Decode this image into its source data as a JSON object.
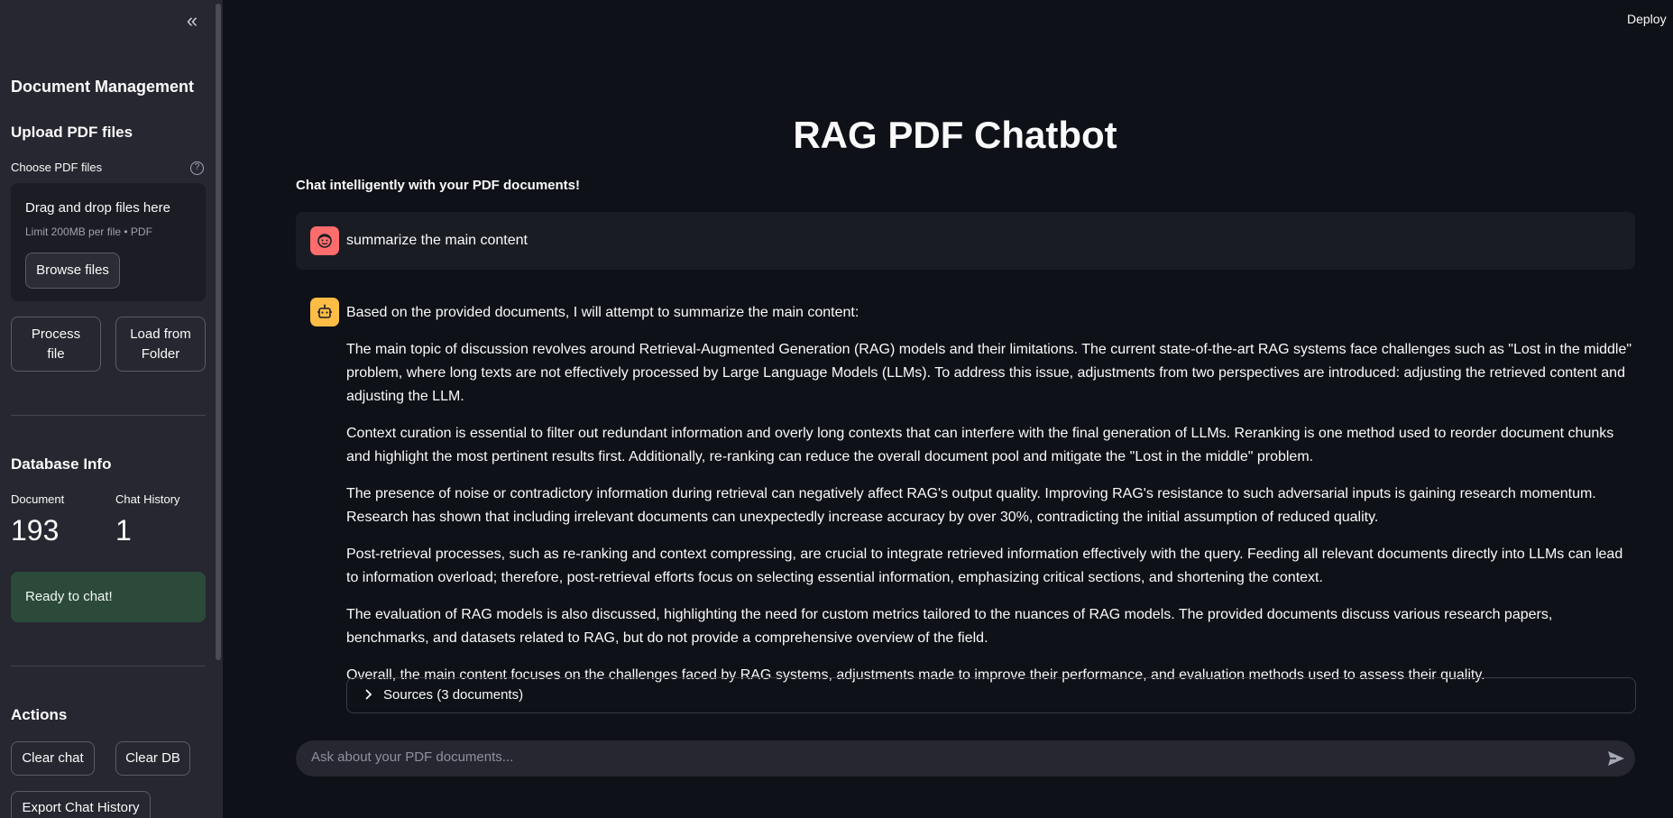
{
  "header": {
    "deploy_label": "Deploy"
  },
  "sidebar": {
    "collapse_icon": "double-chevron-left-icon",
    "section_title": "Document Management",
    "upload_title": "Upload PDF files",
    "file_uploader": {
      "label": "Choose PDF files",
      "drop_text": "Drag and drop files here",
      "limit_text": "Limit 200MB per file • PDF",
      "browse_label": "Browse files"
    },
    "process_button": "Process file",
    "load_button": "Load from Folder",
    "database_title": "Database Info",
    "metrics": [
      {
        "label": "Document",
        "value": "193"
      },
      {
        "label": "Chat History",
        "value": "1"
      }
    ],
    "status_message": "Ready to chat!",
    "actions_title": "Actions",
    "clear_chat_label": "Clear chat",
    "clear_db_label": "Clear DB",
    "export_label": "Export Chat History"
  },
  "main": {
    "title": "RAG PDF Chatbot",
    "subtitle": "Chat intelligently with your PDF documents!",
    "user_message": "summarize the main content",
    "assistant_paragraphs": [
      "Based on the provided documents, I will attempt to summarize the main content:",
      "The main topic of discussion revolves around Retrieval-Augmented Generation (RAG) models and their limitations. The current state-of-the-art RAG systems face challenges such as \"Lost in the middle\" problem, where long texts are not effectively processed by Large Language Models (LLMs). To address this issue, adjustments from two perspectives are introduced: adjusting the retrieved content and adjusting the LLM.",
      "Context curation is essential to filter out redundant information and overly long contexts that can interfere with the final generation of LLMs. Reranking is one method used to reorder document chunks and highlight the most pertinent results first. Additionally, re-ranking can reduce the overall document pool and mitigate the \"Lost in the middle\" problem.",
      "The presence of noise or contradictory information during retrieval can negatively affect RAG's output quality. Improving RAG's resistance to such adversarial inputs is gaining research momentum. Research has shown that including irrelevant documents can unexpectedly increase accuracy by over 30%, contradicting the initial assumption of reduced quality.",
      "Post-retrieval processes, such as re-ranking and context compressing, are crucial to integrate retrieved information effectively with the query. Feeding all relevant documents directly into LLMs can lead to information overload; therefore, post-retrieval efforts focus on selecting essential information, emphasizing critical sections, and shortening the context.",
      "The evaluation of RAG models is also discussed, highlighting the need for custom metrics tailored to the nuances of RAG models. The provided documents discuss various research papers, benchmarks, and datasets related to RAG, but do not provide a comprehensive overview of the field.",
      "Overall, the main content focuses on the challenges faced by RAG systems, adjustments made to improve their performance, and evaluation methods used to assess their quality."
    ],
    "sources_label": "Sources (3 documents)",
    "chat_input_placeholder": "Ask about your PDF documents..."
  },
  "colors": {
    "background": "#0e1117",
    "sidebar": "#262730",
    "user_avatar": "#ff6c6c",
    "assistant_avatar": "#ffbd45",
    "success_bg": "#2c4a3a"
  }
}
